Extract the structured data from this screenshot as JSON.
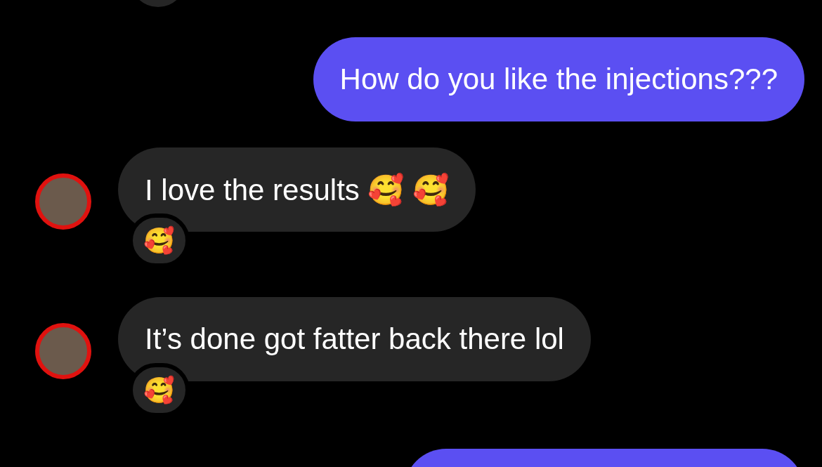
{
  "messages": [
    {
      "kind": "reaction-fragment"
    },
    {
      "kind": "outgoing",
      "text": "How do you like the injections???"
    },
    {
      "kind": "incoming",
      "text": "I love the results 🥰 🥰",
      "reaction": "🥰"
    },
    {
      "kind": "incoming",
      "text": "It’s done got fatter back there lol",
      "reaction": "🥰"
    },
    {
      "kind": "outgoing-cut"
    }
  ]
}
